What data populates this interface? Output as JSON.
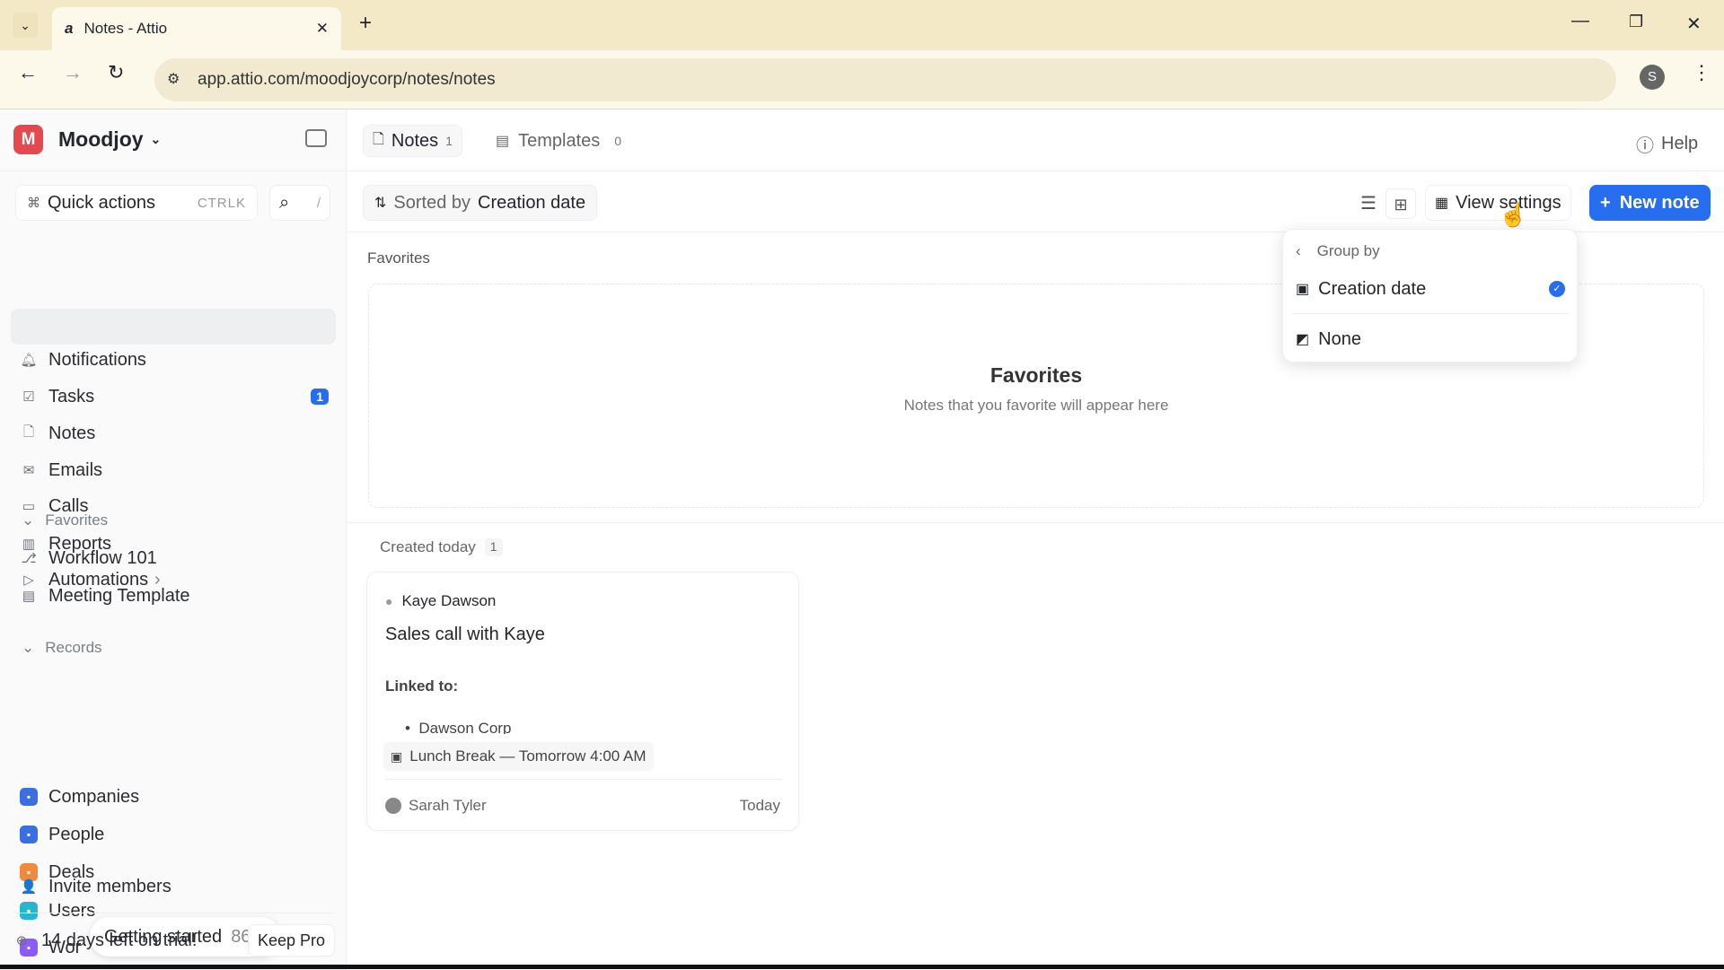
{
  "browser": {
    "tab_title": "Notes - Attio",
    "url": "app.attio.com/moodjoycorp/notes/notes",
    "profile_initial": "S"
  },
  "workspace": {
    "name": "Moodjoy",
    "initial": "M"
  },
  "quick_actions": {
    "label": "Quick actions",
    "shortcut": "CTRLK",
    "search_shortcut": "/"
  },
  "nav": [
    {
      "label": "Notifications",
      "icon": "bell"
    },
    {
      "label": "Tasks",
      "icon": "check",
      "badge": "1"
    },
    {
      "label": "Notes",
      "icon": "note"
    },
    {
      "label": "Emails",
      "icon": "mail"
    },
    {
      "label": "Calls",
      "icon": "video"
    },
    {
      "label": "Reports",
      "icon": "chart"
    },
    {
      "label": "Automations",
      "icon": "play"
    }
  ],
  "favorites": {
    "header": "Favorites",
    "items": [
      "Workflow 101",
      "Meeting Template"
    ]
  },
  "records": {
    "header": "Records",
    "items": [
      {
        "label": "Companies",
        "color": "#3b6fe0"
      },
      {
        "label": "People",
        "color": "#3b6fe0"
      },
      {
        "label": "Deals",
        "color": "#f08a3c"
      },
      {
        "label": "Users",
        "color": "#27b5cf"
      },
      {
        "label": "Wor",
        "color": "#8b5cf6"
      }
    ]
  },
  "getting_started": {
    "label": "Getting started",
    "percent": "86%"
  },
  "invite": "Invite members",
  "trial": {
    "text": "14 days left on trial!",
    "button": "Keep Pro"
  },
  "header": {
    "tabs": [
      {
        "label": "Notes",
        "count": "1"
      },
      {
        "label": "Templates",
        "count": "0"
      }
    ],
    "help": "Help"
  },
  "toolbar": {
    "sort_prefix": "Sorted by",
    "sort_field": "Creation date",
    "view_settings": "View settings",
    "new_note": "New note"
  },
  "dropdown": {
    "title": "Group by",
    "options": [
      {
        "label": "Creation date",
        "selected": true
      },
      {
        "label": "None",
        "selected": false
      }
    ]
  },
  "favorites_section": {
    "label": "Favorites",
    "empty_title": "Favorites",
    "empty_text": "Notes that you favorite will appear here"
  },
  "group": {
    "label": "Created today",
    "count": "1"
  },
  "card": {
    "person": "Kaye Dawson",
    "title": "Sales call with Kaye",
    "linked_label": "Linked to:",
    "linked_item": "Dawson Corp",
    "event": "Lunch Break — Tomorrow 4:00 AM",
    "author": "Sarah Tyler",
    "date": "Today"
  },
  "colors": {
    "accent": "#266df0",
    "workspace": "#e5484d"
  }
}
